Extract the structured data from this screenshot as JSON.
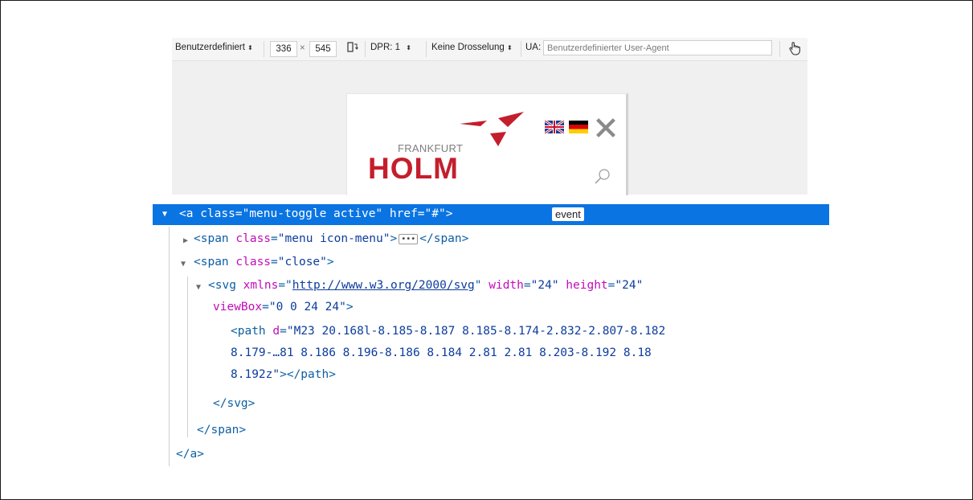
{
  "toolbar": {
    "device_label": "Benutzerdefiniert",
    "width_value": "336",
    "times": "×",
    "height_value": "545",
    "dpr_label": "DPR: 1",
    "throttle_label": "Keine Drosselung",
    "ua_label": "UA:",
    "ua_placeholder": "Benutzerdefinierter User-Agent",
    "select_arrow": "⬍"
  },
  "preview": {
    "logo_top": "FRANKFURT",
    "logo_main": "HOLM",
    "colors": {
      "brand_red": "#c41e2d",
      "logo_gray": "#7e7e7e"
    }
  },
  "inspector": {
    "selected_line": "<a class=\"menu-toggle active\" href=\"#\">",
    "event_badge": "event",
    "lines": {
      "span_menu_open": "<span ",
      "span_menu_attr": "class",
      "span_menu_val": "\"menu icon-menu\"",
      "span_menu_gt": ">",
      "span_menu_close": "</span>",
      "span_close_open": "<span ",
      "span_close_attr": "class",
      "span_close_val": "\"close\"",
      "span_close_gt": ">",
      "svg_open": "<svg ",
      "svg_xmlns": "xmlns",
      "svg_xmlns_val": "http://www.w3.org/2000/svg",
      "svg_width": "width",
      "svg_width_val": "\"24\"",
      "svg_height": "height",
      "svg_height_val": "\"24\"",
      "svg_viewbox": "viewBox",
      "svg_viewbox_val": "\"0 0 24 24\"",
      "svg_gt": ">",
      "path_open": "<path ",
      "path_attr": "d",
      "path_val_1": "\"M23 20.168l-8.185-8.187 8.185-8.174-2.832-2.807-8.182",
      "path_val_2": "8.179-…81 8.186 8.196-8.186 8.184 2.81 2.81 8.203-8.192 8.18",
      "path_val_3": "8.192z\"",
      "path_close": "></path>",
      "svg_close": "</svg>",
      "span_end": "</span>",
      "a_end": "</a>"
    },
    "colors": {
      "selection": "#0a74e2",
      "tag": "#0d5fa3",
      "attr": "#c20cb9",
      "value": "#0d3d9c"
    }
  }
}
